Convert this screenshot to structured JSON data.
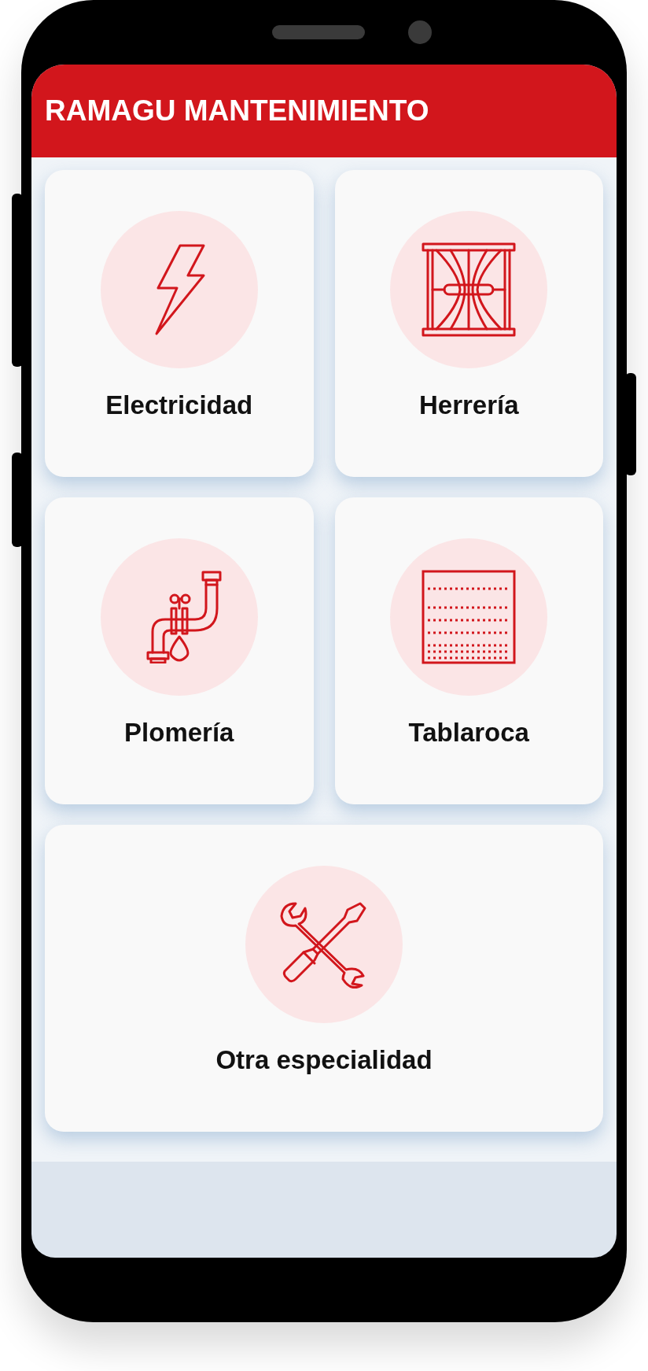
{
  "app_bar": {
    "title": "RAMAGU MANTENIMIENTO"
  },
  "categories": [
    {
      "label": "Electricidad",
      "kind": "bolt"
    },
    {
      "label": "Herrería",
      "kind": "gate"
    },
    {
      "label": "Plomería",
      "kind": "pipe"
    },
    {
      "label": "Tablaroca",
      "kind": "panel"
    },
    {
      "label": "Otra especialidad",
      "kind": "tools"
    }
  ]
}
